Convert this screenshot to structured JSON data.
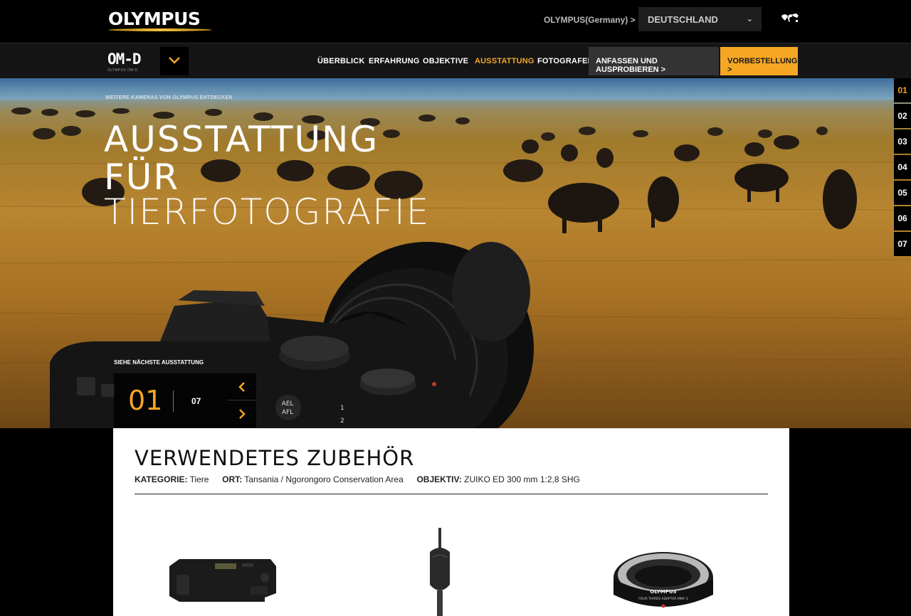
{
  "header": {
    "logo": "OLYMPUS",
    "region_link": "OLYMPUS(Germany) >",
    "country_select": "DEUTSCHLAND",
    "icons": {
      "dropdown": "chevron-down-icon",
      "globe": "world-map-icon"
    }
  },
  "nav": {
    "brand": "OM-D",
    "brand_sub": "OLYMPUS OM-D",
    "items": [
      "ÜBERBLICK",
      "ERFAHRUNG",
      "OBJEKTIVE",
      "AUSSTATTUNG",
      "FOTOGRAFEN"
    ],
    "active_item": "AUSSTATTUNG",
    "try_button": "ANFASSEN UND AUSPROBIEREN >",
    "preorder_button": "VORBESTELLUNG >",
    "colors": {
      "accent": "#f5a623"
    }
  },
  "hero": {
    "discover_link": "WEITERE KAMERAS VON OLYMPUS ENTDECKEN",
    "title_line1": "AUSSTATTUNG",
    "title_line2": "FÜR",
    "title_line3": "TIERFOTOGRAFIE",
    "next_label": "SIEHE NÄCHSTE AUSSTATTUNG",
    "current": "01",
    "total": "07",
    "pager": [
      "01",
      "02",
      "03",
      "04",
      "05",
      "06",
      "07"
    ],
    "active_page": "01",
    "camera_labels": {
      "ael": "AEL",
      "afl": "AFL",
      "one": "1",
      "two": "2"
    }
  },
  "panel": {
    "title": "VERWENDETES ZUBEHÖR",
    "category_label": "KATEGORIE:",
    "category_value": "Tiere",
    "location_label": "ORT:",
    "location_value": "Tansania / Ngorongoro Conservation Area",
    "lens_label": "OBJEKTIV:",
    "lens_value": "ZUIKO ED 300 mm 1:2,8 SHG",
    "products": [
      {
        "name": "battery-grip"
      },
      {
        "name": "hand-strap"
      },
      {
        "name": "four-thirds-adapter",
        "label_1": "OLYMPUS",
        "label_2": "FOUR THIRDS ADAPTER MMF-3"
      }
    ]
  }
}
